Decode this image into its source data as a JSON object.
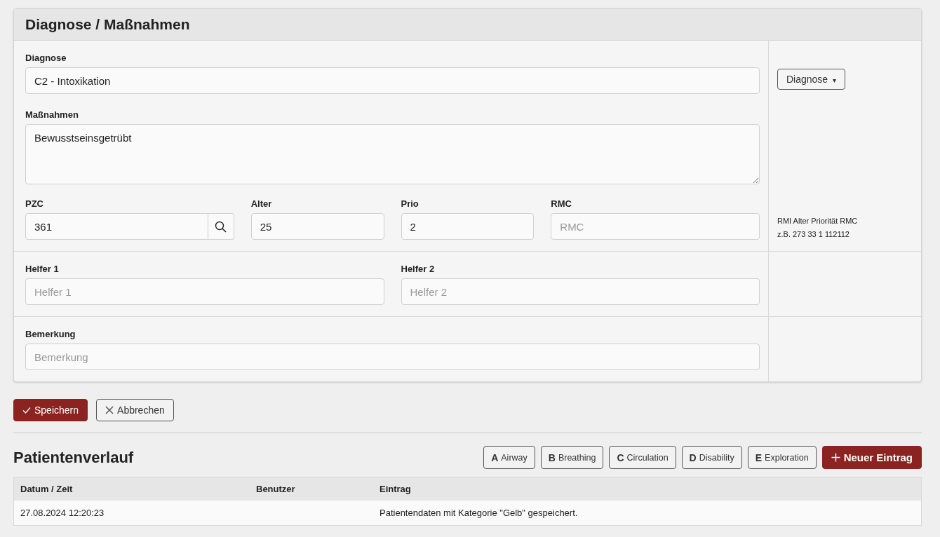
{
  "card": {
    "title": "Diagnose / Maßnahmen",
    "diagnose": {
      "label": "Diagnose",
      "value": "C2 - Intoxikation"
    },
    "massnahmen": {
      "label": "Maßnahmen",
      "value": "Bewusstseinsgetrübt"
    },
    "diagnose_dropdown": {
      "label": "Diagnose",
      "caret": "▾"
    },
    "codes": [
      {
        "kind": "search",
        "label": "PZC",
        "value": "361"
      },
      {
        "kind": "text",
        "label": "Alter",
        "value": "25"
      },
      {
        "kind": "text",
        "label": "Prio",
        "value": "2"
      },
      {
        "kind": "text",
        "label": "RMC",
        "placeholder": "RMC"
      }
    ],
    "hint": [
      "RMI Alter Priorität RMC",
      "z.B. 273 33 1 112112"
    ],
    "helpers": [
      {
        "label": "Helfer 1",
        "placeholder": "Helfer 1"
      },
      {
        "label": "Helfer 2",
        "placeholder": "Helfer 2"
      }
    ],
    "bemerkung": {
      "label": "Bemerkung",
      "placeholder": "Bemerkung"
    }
  },
  "actions": [
    {
      "kind": "save",
      "label": "Speichern"
    },
    {
      "kind": "cancel",
      "label": "Abbrechen"
    }
  ],
  "verlauf": {
    "title": "Patientenverlauf",
    "abcde": [
      {
        "letter": "A",
        "label": "Airway"
      },
      {
        "letter": "B",
        "label": "Breathing"
      },
      {
        "letter": "C",
        "label": "Circulation"
      },
      {
        "letter": "D",
        "label": "Disability"
      },
      {
        "letter": "E",
        "label": "Exploration"
      }
    ],
    "new_entry": "Neuer Eintrag",
    "table": {
      "columns": [
        "Datum / Zeit",
        "Benutzer",
        "Eintrag"
      ],
      "rows": [
        {
          "datum": "27.08.2024 12:20:23",
          "eintrag": "Patientendaten mit Kategorie \"Gelb\" gespeichert."
        }
      ]
    }
  }
}
